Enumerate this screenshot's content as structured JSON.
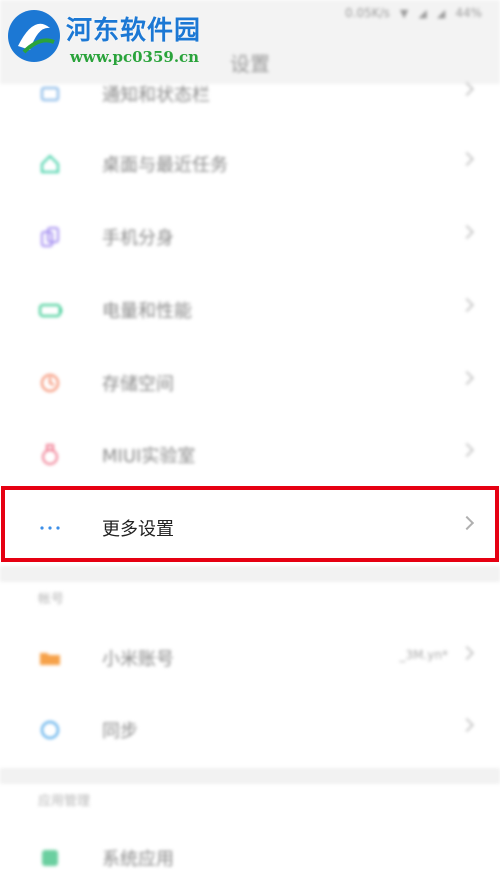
{
  "status_bar": {
    "speed": "0.05K/s",
    "battery": "44%"
  },
  "header": {
    "title": "设置"
  },
  "watermark": {
    "title": "河东软件园",
    "url": "www.pc0359.cn"
  },
  "rows": [
    {
      "label": "通知和状态栏",
      "icon": "notification-icon",
      "color": "#7fb3e6"
    },
    {
      "label": "桌面与最近任务",
      "icon": "home-icon",
      "color": "#3ecfa5"
    },
    {
      "label": "手机分身",
      "icon": "dual-phone-icon",
      "color": "#a48ef0"
    },
    {
      "label": "电量和性能",
      "icon": "battery-icon",
      "color": "#34c98f"
    },
    {
      "label": "存储空间",
      "icon": "storage-icon",
      "color": "#f48a6a"
    },
    {
      "label": "MIUI实验室",
      "icon": "lab-flask-icon",
      "color": "#f07a90"
    },
    {
      "label": "更多设置",
      "icon": "more-dots-icon",
      "color": "#3d8fe8"
    }
  ],
  "sections": {
    "account": {
      "label": "帐号",
      "items": [
        {
          "label": "小米账号",
          "value": "_3M.yn*",
          "icon": "account-folder-icon",
          "color": "#f6a24a"
        },
        {
          "label": "同步",
          "icon": "sync-icon",
          "color": "#4aa5e8"
        }
      ]
    },
    "apps": {
      "label": "应用管理",
      "items": [
        {
          "label": "系统应用",
          "icon": "system-apps-icon",
          "color": "#6bcfa0"
        }
      ]
    }
  }
}
